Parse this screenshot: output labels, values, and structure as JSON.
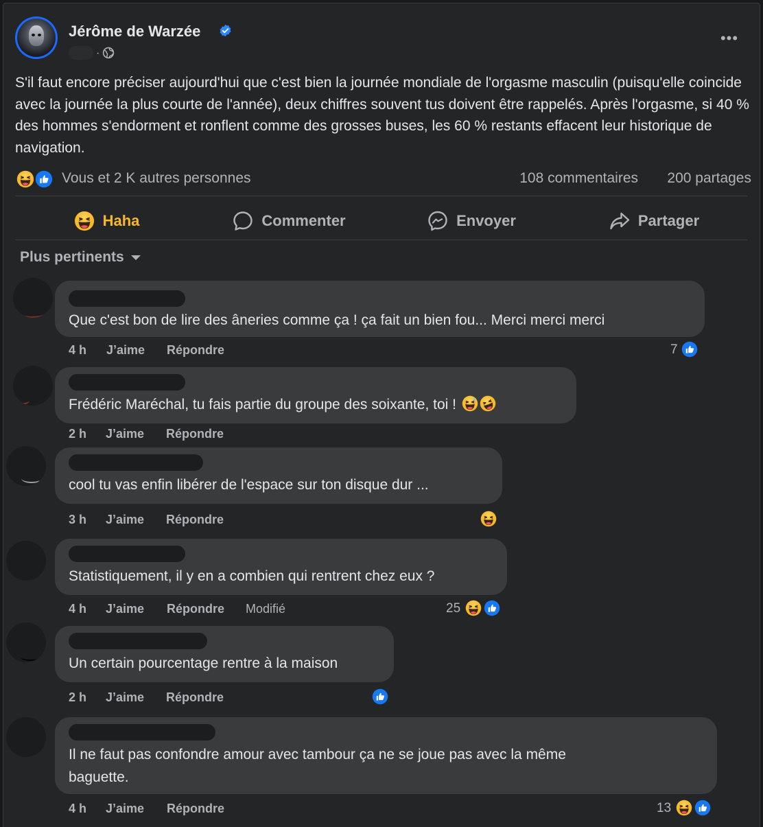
{
  "post": {
    "author": "Jérôme de Warzée",
    "more_label": "•••",
    "text": "S'il faut encore préciser aujourd'hui que c'est bien la journée mondiale de l'orgasme masculin (puisqu'elle coincide avec la journée la plus courte de l'année), deux chiffres souvent tus doivent être rappelés. Après l'orgasme, si 40 % des hommes s'endorment et ronflent comme des grosses buses, les 60 % restants effacent leur historique de navigation.",
    "reactions_text": "Vous et 2 K autres personnes",
    "comments_count": "108 commentaires",
    "shares_count": "200 partages"
  },
  "actions": {
    "haha": "Haha",
    "comment": "Commenter",
    "send": "Envoyer",
    "share": "Partager"
  },
  "sort_label": "Plus pertinents",
  "comments": [
    {
      "text": "Que c'est bon de lire des âneries comme ça ! ça fait un bien fou... Merci merci merci",
      "time": "4 h",
      "like": "J’aime",
      "reply": "Répondre",
      "reactions": "7"
    },
    {
      "text": "Frédéric Maréchal, tu fais partie du groupe des soixante, toi ! ",
      "time": "2 h",
      "like": "J’aime",
      "reply": "Répondre"
    },
    {
      "text": "cool tu vas enfin libérer de l'espace sur ton disque dur ...",
      "time": "3 h",
      "like": "J’aime",
      "reply": "Répondre"
    },
    {
      "text": "Statistiquement, il y en a combien qui rentrent chez eux ?",
      "time": "4 h",
      "like": "J’aime",
      "reply": "Répondre",
      "edited": "Modifié",
      "reactions": "25"
    },
    {
      "text": "Un certain pourcentage rentre à la maison",
      "time": "2 h",
      "like": "J’aime",
      "reply": "Répondre"
    },
    {
      "text_line1": "Il ne faut pas confondre amour avec tambour ça ne se joue pas avec la même",
      "text_line2": "baguette.",
      "time": "4 h",
      "like": "J’aime",
      "reply": "Répondre",
      "reactions": "13"
    }
  ],
  "colors": {
    "background": "#18191a",
    "card": "#242526",
    "bubble": "#3a3b3c",
    "haha_yellow": "#f7b928",
    "like_blue": "#1877f2",
    "verified_blue": "#2d88ff"
  },
  "icons": [
    "verified-badge-icon",
    "globe-icon",
    "haha-icon",
    "like-icon",
    "comment-icon",
    "messenger-icon",
    "share-icon",
    "sort-caret-icon"
  ]
}
